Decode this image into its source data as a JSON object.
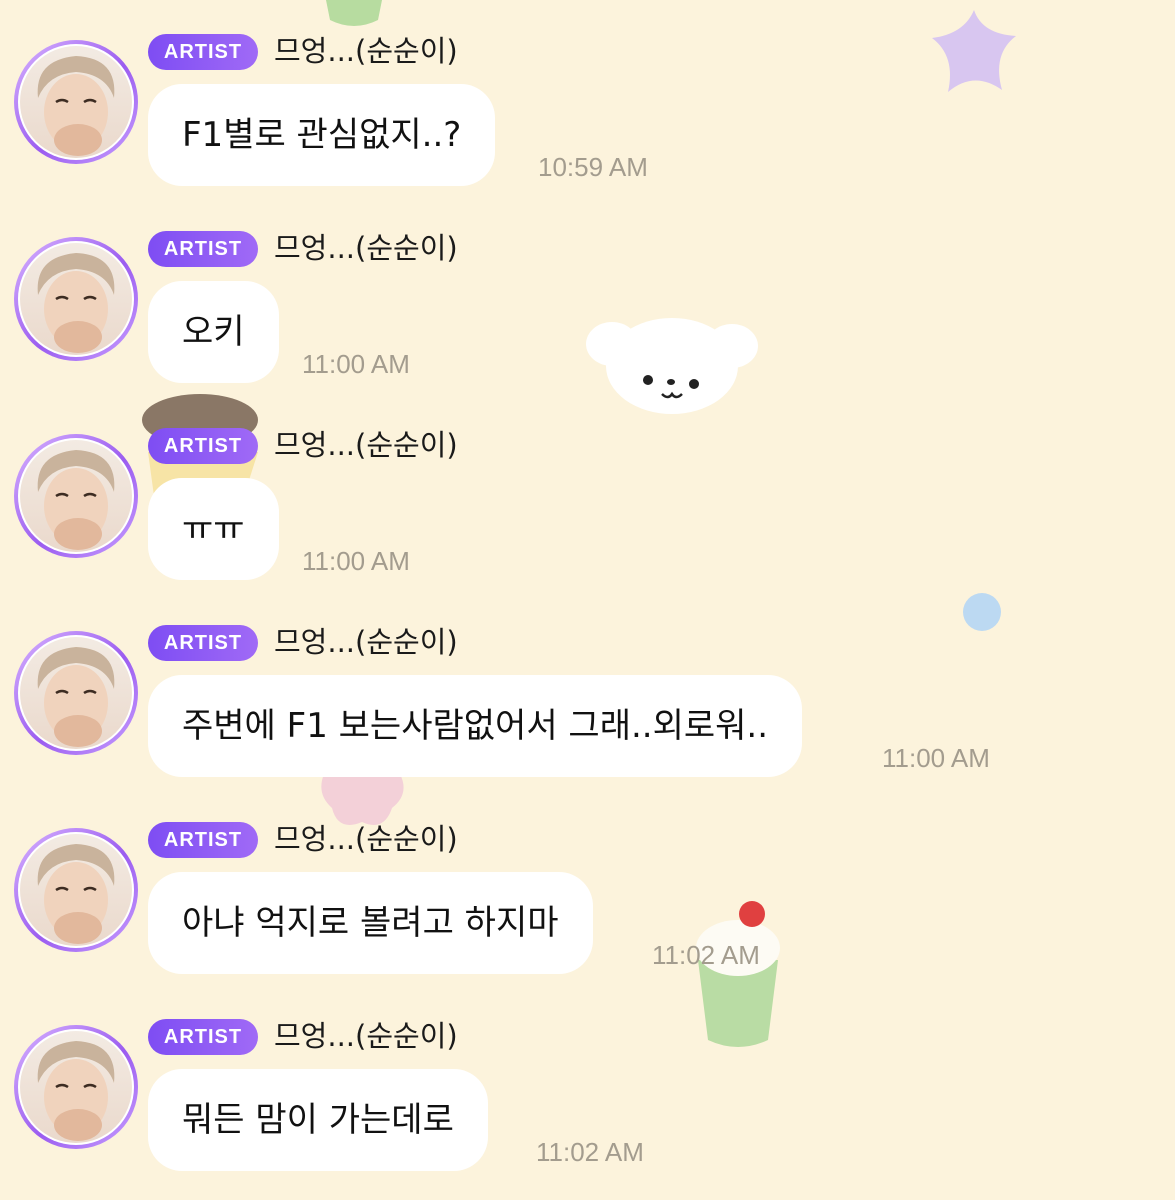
{
  "badge_label": "ARTIST",
  "sender_name": "므엉...(순순이)",
  "messages": [
    {
      "text": "F1별로 관심없지..?",
      "time": "10:59 AM"
    },
    {
      "text": "오키",
      "time": "11:00 AM"
    },
    {
      "text": "ㅠㅠ",
      "time": "11:00 AM"
    },
    {
      "text": "주변에 F1 보는사람없어서 그래..외로워..",
      "time": "11:00 AM"
    },
    {
      "text": "아냐 억지로 볼려고 하지마",
      "time": "11:02 AM"
    },
    {
      "text": "뭐든 맘이 가는데로",
      "time": "11:02 AM"
    }
  ],
  "colors": {
    "background": "#fcf3dc",
    "badge": "#8a57f4",
    "bubble": "#ffffff",
    "timestamp": "#a39c8e"
  },
  "decorations": [
    "green-cup-sticker",
    "purple-star-sticker",
    "white-puppy-sticker",
    "cake-sticker",
    "blue-dot-sticker",
    "pink-star-sticker",
    "melon-cream-soda-sticker"
  ]
}
